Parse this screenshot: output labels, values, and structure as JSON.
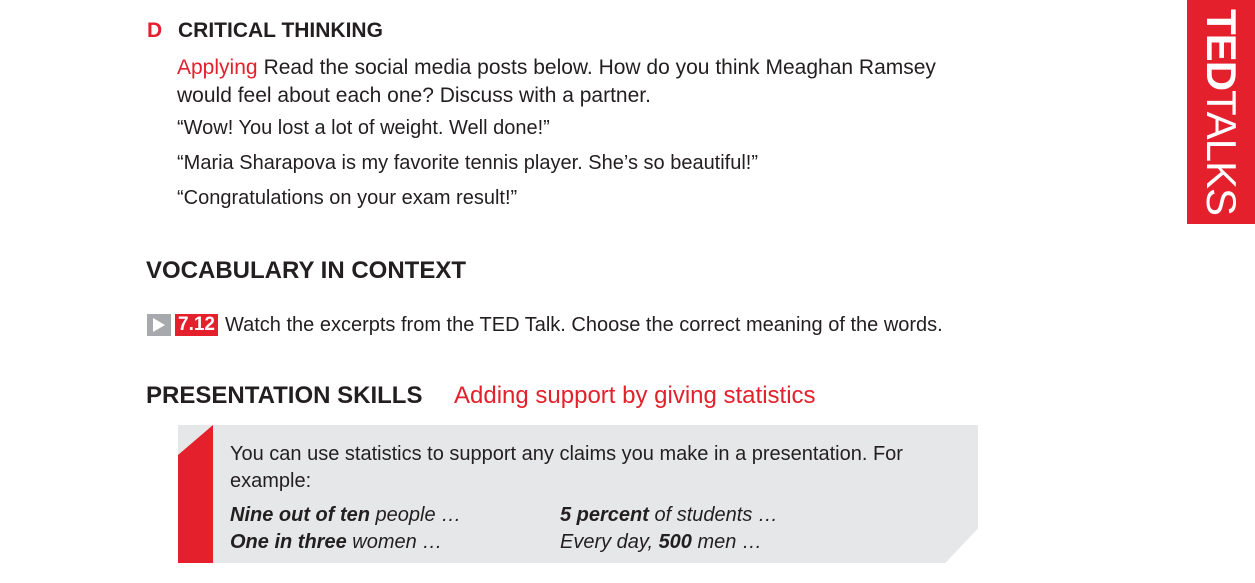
{
  "critical_thinking": {
    "letter": "D",
    "title": "CRITICAL THINKING",
    "skill_label": "Applying",
    "instruction": "Read the social media posts below. How do you think Meaghan Ramsey would feel about each one? Discuss with a partner.",
    "posts": [
      "“Wow! You lost a lot of weight. Well done!”",
      "“Maria Sharapova is my favorite tennis player. She’s so beautiful!”",
      "“Congratulations on your exam result!”"
    ]
  },
  "vocabulary": {
    "title": "VOCABULARY IN CONTEXT",
    "play_icon": "play-triangle-icon",
    "video_number": "7.12",
    "instruction": "Watch the excerpts from the TED Talk. Choose the correct meaning of the words."
  },
  "presentation_skills": {
    "title": "PRESENTATION SKILLS",
    "subtitle": "Adding support by giving statistics",
    "intro": "You can use statistics to support any claims you make in a presentation. For example:",
    "examples": [
      {
        "bold": "Nine out of ten",
        "rest": " people …"
      },
      {
        "bold": "One in three",
        "rest": " women …"
      },
      {
        "bold": "5 percent",
        "rest": " of students …"
      },
      {
        "pre": "Every day, ",
        "bold": "500",
        "rest": " men …"
      }
    ]
  },
  "side_tab": {
    "bold": "TED",
    "light": "TALKS"
  },
  "colors": {
    "accent_red": "#e3202c",
    "box_gray": "#e6e7e8",
    "icon_gray": "#a7a9ac",
    "text": "#231f20"
  }
}
